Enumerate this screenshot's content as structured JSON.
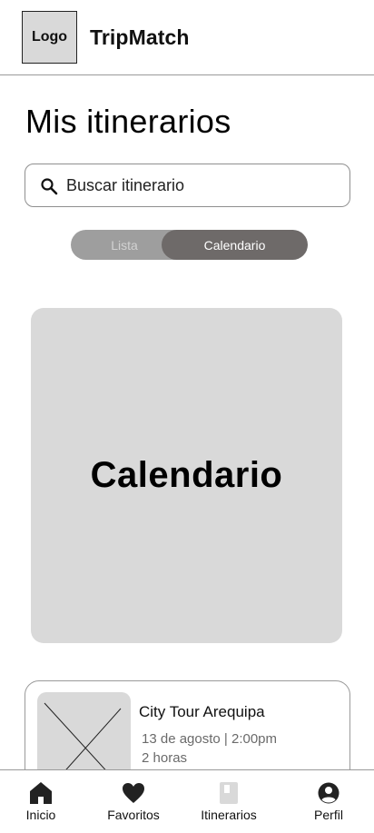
{
  "header": {
    "logo_label": "Logo",
    "app_title": "TripMatch"
  },
  "page": {
    "title": "Mis itinerarios"
  },
  "search": {
    "placeholder": "Buscar itinerario",
    "icon": "search-icon"
  },
  "view_toggle": {
    "options": [
      {
        "label": "Lista",
        "selected": false
      },
      {
        "label": "Calendario",
        "selected": true
      }
    ]
  },
  "calendar": {
    "placeholder_label": "Calendario"
  },
  "itinerary_cards": [
    {
      "title": "City Tour Arequipa",
      "date_time": "13 de agosto | 2:00pm",
      "duration": "2 horas",
      "image": "image-placeholder"
    }
  ],
  "bottom_nav": {
    "items": [
      {
        "label": "Inicio",
        "icon": "home-icon"
      },
      {
        "label": "Favoritos",
        "icon": "heart-icon"
      },
      {
        "label": "Itinerarios",
        "icon": "book-icon"
      },
      {
        "label": "Perfil",
        "icon": "user-icon"
      }
    ]
  },
  "colors": {
    "placeholder_gray": "#d9d9d9",
    "toggle_track": "#9e9e9e",
    "toggle_active": "#6e6a69",
    "border_gray": "#9a9a9a",
    "muted_text": "#6a6a6a"
  }
}
